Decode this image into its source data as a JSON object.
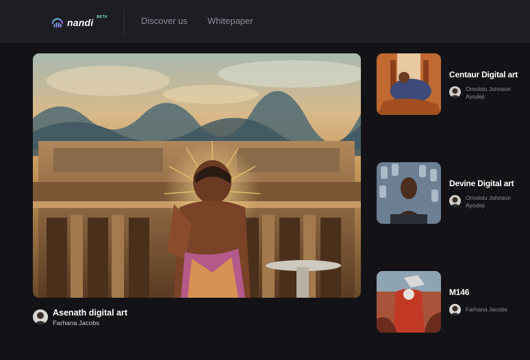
{
  "header": {
    "logo_text": "nandi",
    "logo_badge": "BETA",
    "nav": [
      {
        "label": "Discover us"
      },
      {
        "label": "Whitepaper"
      }
    ]
  },
  "featured": {
    "title": "Asenath digital art",
    "author": "Farhana Jacobs"
  },
  "cards": [
    {
      "title": "Centaur Digital art",
      "author": "Omololu Johnson Ayodeji"
    },
    {
      "title": "Devine Digital art",
      "author": "Omololu Johnson Ayodeji"
    },
    {
      "title": "M146",
      "author": "Farhana Jacobs"
    }
  ],
  "colors": {
    "background": "#131317",
    "topbar": "#1d1e24",
    "nav_text": "#8d8f98",
    "beta_accent": "#7be3c8"
  },
  "icons": {
    "logo": "nandi-logo-icon"
  }
}
